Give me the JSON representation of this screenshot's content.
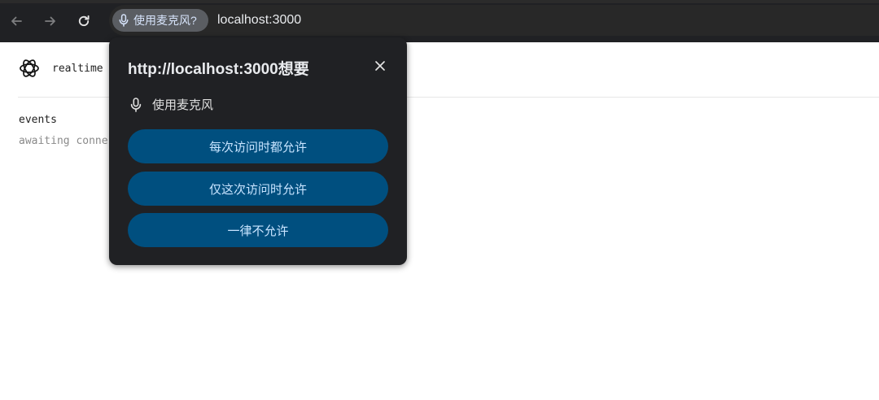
{
  "browser": {
    "permission_chip_label": "使用麦克风?",
    "url": "localhost:3000"
  },
  "page": {
    "app_name": "realtime",
    "events_title": "events",
    "events_status": "awaiting conne"
  },
  "permission_popup": {
    "title": "http://localhost:3000想要",
    "permission_label": "使用麦克风",
    "buttons": {
      "allow_always": "每次访问时都允许",
      "allow_this_time": "仅这次访问时允许",
      "never_allow": "一律不允许"
    }
  },
  "colors": {
    "toolbar_bg": "#202124",
    "popup_bg": "#202124",
    "popup_button_bg": "#004f7f",
    "popup_button_text": "#c8e4ff",
    "chip_bg": "#5a5d62"
  },
  "icons": {
    "back": "arrow-left-icon",
    "forward": "arrow-right-icon",
    "reload": "reload-icon",
    "mic": "microphone-icon",
    "close": "close-icon",
    "logo": "openai-logo-icon"
  }
}
